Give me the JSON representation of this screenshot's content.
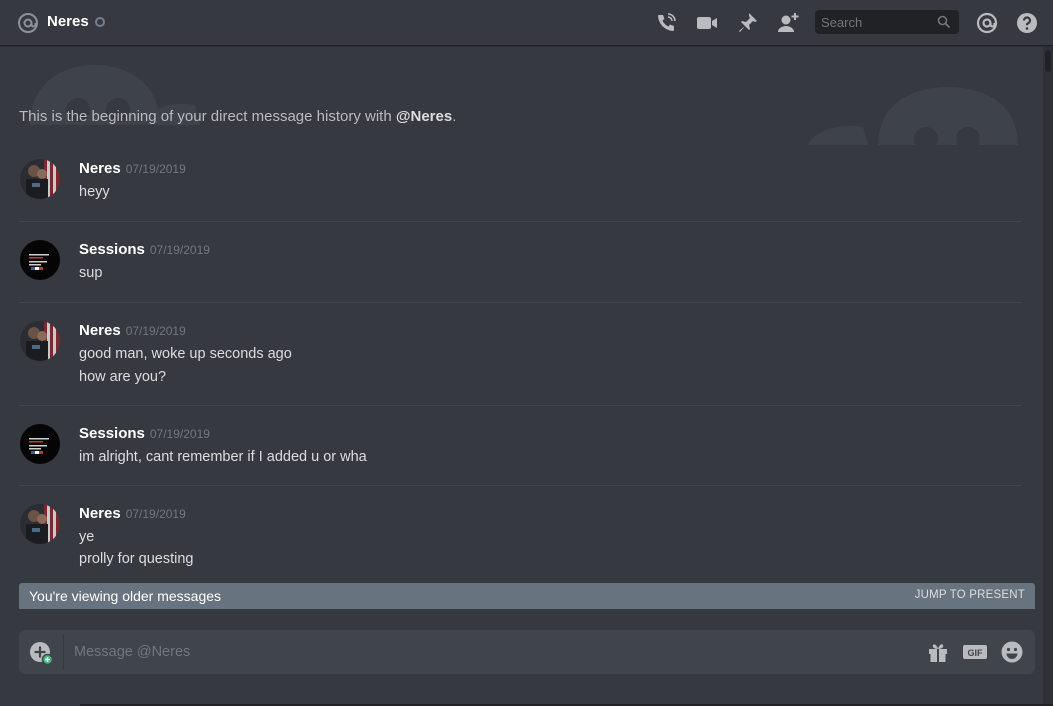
{
  "header": {
    "title": "Neres",
    "search_placeholder": "Search"
  },
  "intro": {
    "text": "This is the beginning of your direct message history with ",
    "mention": "@Neres",
    "end": "."
  },
  "messages": [
    {
      "author": "Neres",
      "timestamp": "07/19/2019",
      "lines": [
        "heyy"
      ]
    },
    {
      "author": "Sessions",
      "timestamp": "07/19/2019",
      "lines": [
        "sup"
      ]
    },
    {
      "author": "Neres",
      "timestamp": "07/19/2019",
      "lines": [
        "good man, woke up seconds ago",
        "how are you?"
      ]
    },
    {
      "author": "Sessions",
      "timestamp": "07/19/2019",
      "lines": [
        "im alright, cant remember if I added u or wha"
      ]
    },
    {
      "author": "Neres",
      "timestamp": "07/19/2019",
      "lines": [
        "ye",
        "prolly for questing"
      ]
    }
  ],
  "older_bar": {
    "text": "You're viewing older messages",
    "jump_label": "JUMP TO PRESENT"
  },
  "composer": {
    "placeholder": "Message @Neres"
  },
  "colors": {
    "background": "#36393f",
    "header_text": "#ffffff",
    "muted": "#72767d",
    "older_bar": "#687380",
    "composer": "#40444b",
    "online_green": "#43b581"
  }
}
